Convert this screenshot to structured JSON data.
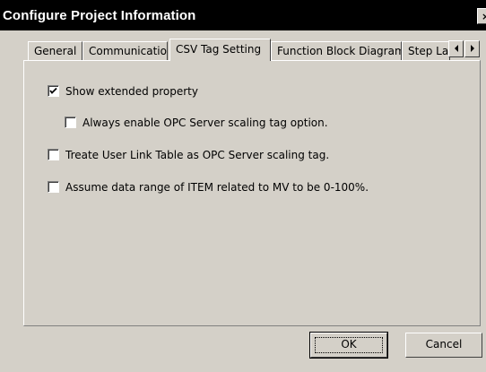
{
  "window": {
    "title": "Configure Project Information",
    "close_glyph": "×"
  },
  "tabs": [
    {
      "label": "General",
      "active": false
    },
    {
      "label": "Communication",
      "active": false
    },
    {
      "label": "CSV Tag Setting",
      "active": true
    },
    {
      "label": "Function Block Diagram",
      "active": false
    },
    {
      "label": "Step La",
      "active": false
    }
  ],
  "tab_scroll": {
    "left_icon": "left-arrow-icon",
    "right_icon": "right-arrow-icon"
  },
  "options": [
    {
      "label": "Show extended property",
      "checked": true
    },
    {
      "label": "Always enable OPC Server scaling tag option.",
      "checked": false
    },
    {
      "label": "Treate User Link Table as OPC Server scaling tag.",
      "checked": false
    },
    {
      "label": "Assume data range of ITEM related to MV to be 0-100%.",
      "checked": false
    }
  ],
  "buttons": {
    "ok_label": "OK",
    "cancel_label": "Cancel"
  },
  "colors": {
    "face": "#d4d0c8",
    "title_bar": "#000000"
  }
}
